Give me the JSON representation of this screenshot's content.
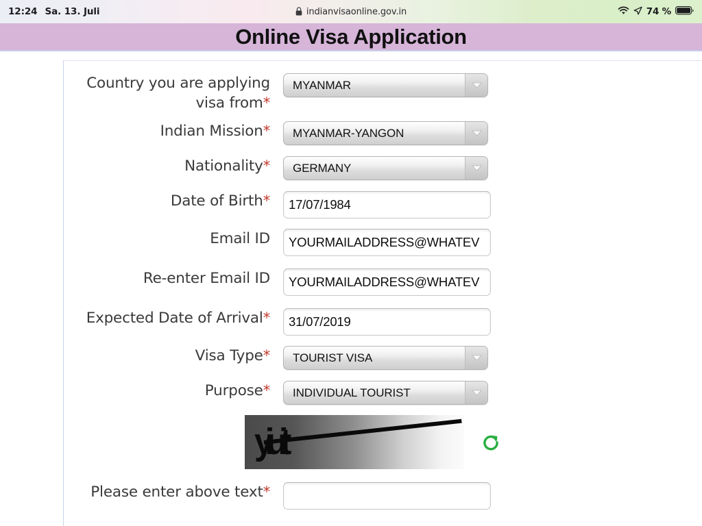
{
  "statusbar": {
    "time": "12:24",
    "date": "Sa. 13. Juli",
    "battery_percent": "74 %",
    "wifi_icon": "wifi-icon",
    "location_icon": "location-arrow-icon",
    "battery_icon": "battery-icon",
    "url": "indianvisaonline.gov.in",
    "lock_icon": "lock-icon"
  },
  "page": {
    "title": "Online Visa Application",
    "title_band_color": "#d6b5d9",
    "required_marker": "*",
    "required_color": "#c0392b"
  },
  "form": {
    "fields": [
      {
        "label": "Country you are applying\nvisa from",
        "required": true,
        "control": "select",
        "value": "MYANMAR"
      },
      {
        "label": "Indian Mission",
        "required": true,
        "control": "select",
        "value": "MYANMAR-YANGON"
      },
      {
        "label": "Nationality",
        "required": true,
        "control": "select",
        "value": "GERMANY"
      },
      {
        "label": "Date of Birth",
        "required": true,
        "control": "text",
        "value": "17/07/1984"
      },
      {
        "label": "Email ID",
        "required": false,
        "control": "text",
        "value": "YOURMAILADDRESS@WHATEV"
      },
      {
        "label": "Re-enter Email ID",
        "required": false,
        "control": "text",
        "value": "YOURMAILADDRESS@WHATEV"
      },
      {
        "label": "Expected Date of Arrival",
        "required": true,
        "control": "text",
        "value": "31/07/2019"
      },
      {
        "label": "Visa Type",
        "required": true,
        "control": "select",
        "value": "TOURIST VISA"
      },
      {
        "label": "Purpose",
        "required": true,
        "control": "select",
        "value": "INDIVIDUAL TOURIST"
      }
    ],
    "captcha": {
      "glyph_text": "yiuit",
      "refresh_icon": "refresh-icon",
      "refresh_color": "#27ae3f",
      "answer_label": "Please enter above text",
      "answer_required": true,
      "answer_value": ""
    }
  }
}
